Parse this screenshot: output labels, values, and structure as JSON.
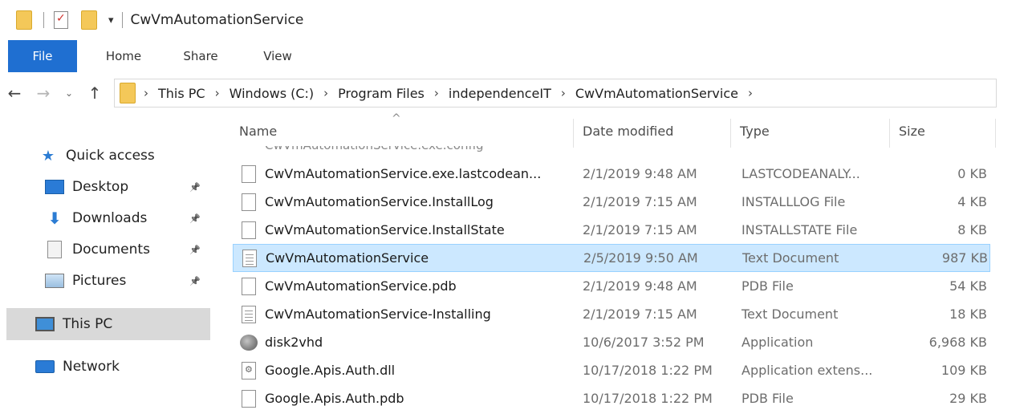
{
  "window": {
    "title": "CwVmAutomationService",
    "qat_dropdown": "▾"
  },
  "ribbon": {
    "tabs": [
      "File",
      "Home",
      "Share",
      "View"
    ]
  },
  "nav": {
    "back": "←",
    "forward": "→",
    "recent": "⌄",
    "up": "↑"
  },
  "address": {
    "separator": "›",
    "crumbs": [
      "This PC",
      "Windows (C:)",
      "Program Files",
      "independenceIT",
      "CwVmAutomationService"
    ]
  },
  "sidebar": {
    "pin_glyph": "📌",
    "items": [
      {
        "label": "Quick access",
        "icon": "star-icon",
        "pinned": false
      },
      {
        "label": "Desktop",
        "icon": "desktop-icon",
        "pinned": true
      },
      {
        "label": "Downloads",
        "icon": "downloads-icon",
        "pinned": true
      },
      {
        "label": "Documents",
        "icon": "documents-icon",
        "pinned": true
      },
      {
        "label": "Pictures",
        "icon": "pictures-icon",
        "pinned": true
      },
      {
        "label": "This PC",
        "icon": "computer-icon",
        "pinned": false,
        "selected": true
      },
      {
        "label": "Network",
        "icon": "network-icon",
        "pinned": false
      }
    ]
  },
  "filelist": {
    "sort_indicator": "^",
    "columns": {
      "name": "Name",
      "date": "Date modified",
      "type": "Type",
      "size": "Size"
    },
    "partial_top_row": "CwVmAutomationService.exe.config",
    "rows": [
      {
        "name": "CwVmAutomationService.exe.lastcodean...",
        "date": "2/1/2019 9:48 AM",
        "type": "LASTCODEANALY...",
        "size": "0 KB",
        "icon": "blank-file-icon",
        "selected": false
      },
      {
        "name": "CwVmAutomationService.InstallLog",
        "date": "2/1/2019 7:15 AM",
        "type": "INSTALLLOG File",
        "size": "4 KB",
        "icon": "blank-file-icon",
        "selected": false
      },
      {
        "name": "CwVmAutomationService.InstallState",
        "date": "2/1/2019 7:15 AM",
        "type": "INSTALLSTATE File",
        "size": "8 KB",
        "icon": "blank-file-icon",
        "selected": false
      },
      {
        "name": "CwVmAutomationService",
        "date": "2/5/2019 9:50 AM",
        "type": "Text Document",
        "size": "987 KB",
        "icon": "text-file-icon",
        "selected": true
      },
      {
        "name": "CwVmAutomationService.pdb",
        "date": "2/1/2019 9:48 AM",
        "type": "PDB File",
        "size": "54 KB",
        "icon": "blank-file-icon",
        "selected": false
      },
      {
        "name": "CwVmAutomationService-Installing",
        "date": "2/1/2019 7:15 AM",
        "type": "Text Document",
        "size": "18 KB",
        "icon": "text-file-icon",
        "selected": false
      },
      {
        "name": "disk2vhd",
        "date": "10/6/2017 3:52 PM",
        "type": "Application",
        "size": "6,968 KB",
        "icon": "application-icon",
        "selected": false
      },
      {
        "name": "Google.Apis.Auth.dll",
        "date": "10/17/2018 1:22 PM",
        "type": "Application extens...",
        "size": "109 KB",
        "icon": "dll-file-icon",
        "selected": false
      },
      {
        "name": "Google.Apis.Auth.pdb",
        "date": "10/17/2018 1:22 PM",
        "type": "PDB File",
        "size": "29 KB",
        "icon": "blank-file-icon",
        "selected": false
      }
    ]
  }
}
